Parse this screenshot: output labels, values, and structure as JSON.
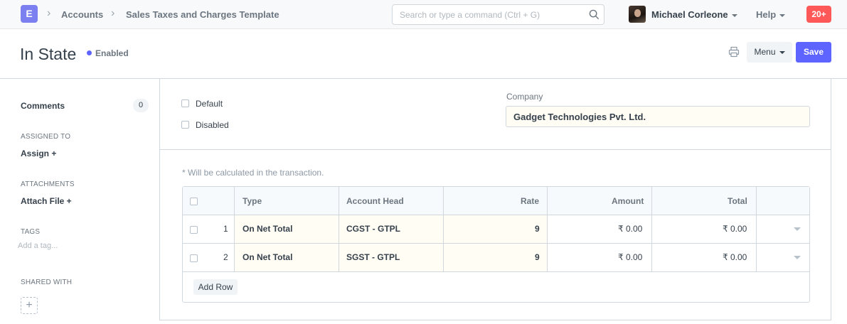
{
  "navbar": {
    "logo_letter": "E",
    "breadcrumbs": [
      "Accounts",
      "Sales Taxes and Charges Template"
    ],
    "search_placeholder": "Search or type a command (Ctrl + G)",
    "user_name": "Michael Corleone",
    "help_label": "Help",
    "notification_count": "20+"
  },
  "page": {
    "title": "In State",
    "status": "Enabled",
    "menu_label": "Menu",
    "save_label": "Save"
  },
  "sidebar": {
    "comments_label": "Comments",
    "comments_count": "0",
    "assigned_to_caption": "ASSIGNED TO",
    "assign_label": "Assign +",
    "attachments_caption": "ATTACHMENTS",
    "attach_label": "Attach File +",
    "tags_caption": "TAGS",
    "tag_placeholder": "Add a tag...",
    "shared_with_caption": "SHARED WITH"
  },
  "form": {
    "default_label": "Default",
    "disabled_label": "Disabled",
    "company_label": "Company",
    "company_value": "Gadget Technologies Pvt. Ltd.",
    "note": "* Will be calculated in the transaction."
  },
  "grid": {
    "columns": {
      "type": "Type",
      "account_head": "Account Head",
      "rate": "Rate",
      "amount": "Amount",
      "total": "Total"
    },
    "rows": [
      {
        "idx": "1",
        "type": "On Net Total",
        "account_head": "CGST - GTPL",
        "rate": "9",
        "amount": "₹ 0.00",
        "total": "₹ 0.00"
      },
      {
        "idx": "2",
        "type": "On Net Total",
        "account_head": "SGST - GTPL",
        "rate": "9",
        "amount": "₹ 0.00",
        "total": "₹ 0.00"
      }
    ],
    "add_row_label": "Add Row"
  },
  "colors": {
    "brand": "#5e64ff",
    "notification": "#ff5858",
    "logo": "#7b7ff0"
  }
}
